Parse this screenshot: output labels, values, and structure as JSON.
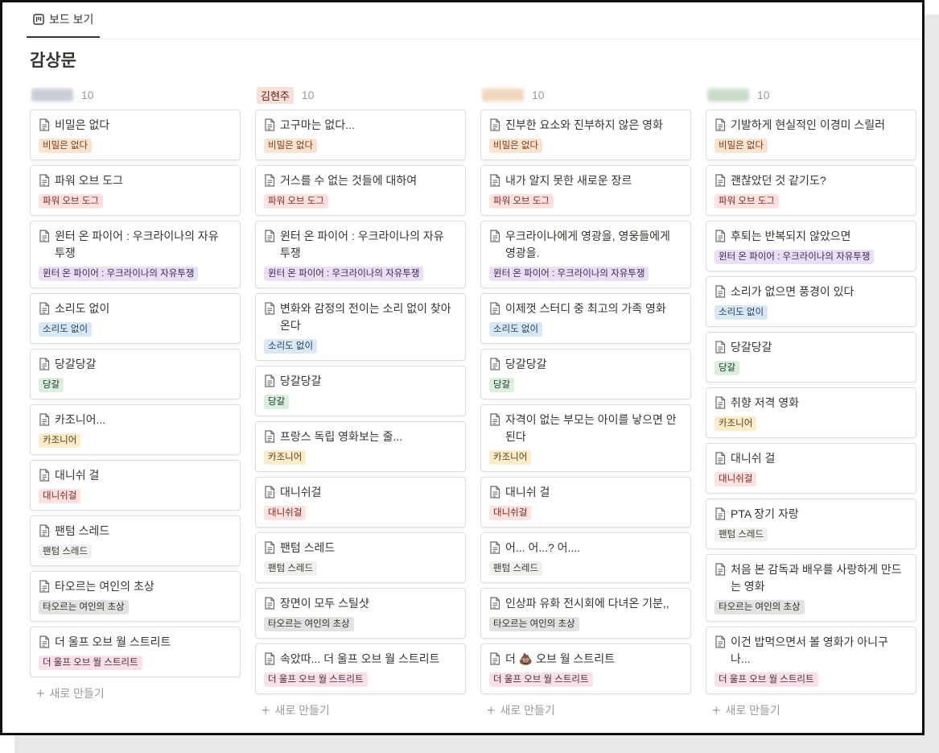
{
  "tab": {
    "label": "보드 보기"
  },
  "title": "감상문",
  "new_label": "새로 만들기",
  "tag_colors": {
    "비밀은 없다": {
      "bg": "#fae3d0",
      "fg": "#7a3a12"
    },
    "파워 오브 도그": {
      "bg": "#fde2e0",
      "fg": "#7f1f1a"
    },
    "윈터 온 파이어 : 우크라이나의 자유투쟁": {
      "bg": "#e9e0f5",
      "fg": "#412454"
    },
    "소리도 없이": {
      "bg": "#d9e8f4",
      "fg": "#1e3d5a"
    },
    "당갈": {
      "bg": "#dcefdf",
      "fg": "#1c3829"
    },
    "카조니어": {
      "bg": "#fbeccc",
      "fg": "#5a3e0e"
    },
    "대니쉬걸": {
      "bg": "#fde2e0",
      "fg": "#7f1f1a"
    },
    "팬텀 스레드": {
      "bg": "#f1f1ef",
      "fg": "#37352f"
    },
    "타오르는 여인의 초상": {
      "bg": "#e3e2e0",
      "fg": "#32302c"
    },
    "더 울프 오브 월 스트리트": {
      "bg": "#f9e1e8",
      "fg": "#4c2337"
    }
  },
  "columns": [
    {
      "author_type": "blur",
      "blur_color": "#c9ced6",
      "count": "10",
      "cards": [
        {
          "title": "비밀은 없다",
          "tag": "비밀은 없다"
        },
        {
          "title": "파워 오브 도그",
          "tag": "파워 오브 도그"
        },
        {
          "title": "윈터 온 파이어 : 우크라이나의 자유 투쟁",
          "tag": "윈터 온 파이어 : 우크라이나의 자유투쟁"
        },
        {
          "title": "소리도 없이",
          "tag": "소리도 없이"
        },
        {
          "title": "당갈당갈",
          "tag": "당갈"
        },
        {
          "title": "카조니어...",
          "tag": "카조니어"
        },
        {
          "title": "대니쉬 걸",
          "tag": "대니쉬걸"
        },
        {
          "title": "팬텀 스레드",
          "tag": "팬텀 스레드"
        },
        {
          "title": "타오르는 여인의 초상",
          "tag": "타오르는 여인의 초상"
        },
        {
          "title": "더 울프 오브 월 스트리트",
          "tag": "더 울프 오브 월 스트리트"
        }
      ]
    },
    {
      "author_type": "tag",
      "author": "김현주",
      "count": "10",
      "cards": [
        {
          "title": "고구마는 없다...",
          "tag": "비밀은 없다"
        },
        {
          "title": "거스를 수 없는 것들에 대하여",
          "tag": "파워 오브 도그"
        },
        {
          "title": "윈터 온 파이어 : 우크라이나의 자유 투쟁",
          "tag": "윈터 온 파이어 : 우크라이나의 자유투쟁"
        },
        {
          "title": "변화와 감정의 전이는 소리 없이 찾아온다",
          "tag": "소리도 없이"
        },
        {
          "title": "당갈당갈",
          "tag": "당갈"
        },
        {
          "title": "프랑스 독립 영화보는 줄...",
          "tag": "카조니어"
        },
        {
          "title": "대니쉬걸",
          "tag": "대니쉬걸"
        },
        {
          "title": "팬텀 스레드",
          "tag": "팬텀 스레드"
        },
        {
          "title": "장면이 모두 스틸샷",
          "tag": "타오르는 여인의 초상"
        },
        {
          "title": "속았따... 더 울프 오브 월 스트리트",
          "tag": "더 울프 오브 월 스트리트"
        }
      ]
    },
    {
      "author_type": "blur",
      "blur_color": "#efd7bf",
      "count": "10",
      "cards": [
        {
          "title": "진부한 요소와 진부하지 않은 영화",
          "tag": "비밀은 없다"
        },
        {
          "title": "내가 알지 못한 새로운 장르",
          "tag": "파워 오브 도그"
        },
        {
          "title": "우크라이나에게 영광을, 영웅들에게 영광을.",
          "tag": "윈터 온 파이어 : 우크라이나의 자유투쟁"
        },
        {
          "title": "이제껏 스터디 중 최고의 가족 영화",
          "tag": "소리도 없이"
        },
        {
          "title": "당갈당갈",
          "tag": "당갈"
        },
        {
          "title": "자격이 없는 부모는 아이를 낳으면 안 된다",
          "tag": "카조니어"
        },
        {
          "title": "대니쉬 걸",
          "tag": "대니쉬걸"
        },
        {
          "title": "어... 어...? 어....",
          "tag": "팬텀 스레드"
        },
        {
          "title": "인상파 유화 전시회에 다녀온 기분,,",
          "tag": "타오르는 여인의 초상"
        },
        {
          "title": "더 💩 오브 월 스트리트",
          "tag": "더 울프 오브 월 스트리트"
        }
      ]
    },
    {
      "author_type": "blur",
      "blur_color": "#c8dcc9",
      "count": "10",
      "cards": [
        {
          "title": "기발하게 현실적인 이경미 스릴러",
          "tag": "비밀은 없다"
        },
        {
          "title": "괜찮았던 것 같기도?",
          "tag": "파워 오브 도그"
        },
        {
          "title": "후퇴는 반복되지 않았으면",
          "tag": "윈터 온 파이어 : 우크라이나의 자유투쟁"
        },
        {
          "title": "소리가 없으면 풍경이 있다",
          "tag": "소리도 없이"
        },
        {
          "title": "당갈당갈",
          "tag": "당갈"
        },
        {
          "title": "취향 저격 영화",
          "tag": "카조니어"
        },
        {
          "title": "대니쉬 걸",
          "tag": "대니쉬걸"
        },
        {
          "title": "PTA 장기 자랑",
          "tag": "팬텀 스레드"
        },
        {
          "title": "처음 본 감독과 배우를 사랑하게 만드는 영화",
          "tag": "타오르는 여인의 초상"
        },
        {
          "title": "이건 밥먹으면서 볼 영화가 아니구나...",
          "tag": "더 울프 오브 월 스트리트"
        }
      ]
    }
  ]
}
